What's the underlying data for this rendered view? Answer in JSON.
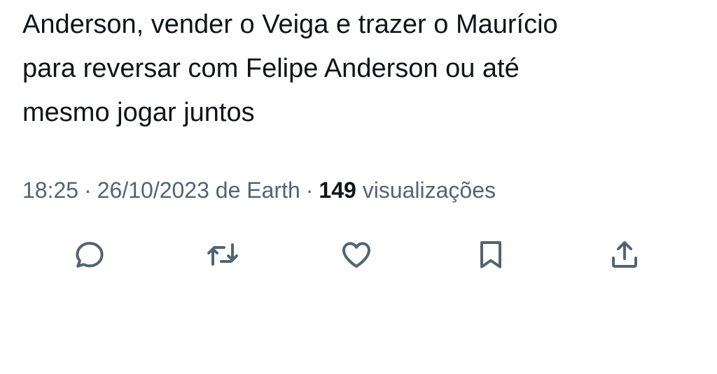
{
  "tweet": {
    "text_lines": [
      "Anderson, vender o Veiga e trazer o Maurício",
      "para reversar com Felipe Anderson ou até",
      "mesmo jogar juntos"
    ]
  },
  "meta": {
    "time": "18:25",
    "date": "26/10/2023",
    "source_prefix": "de",
    "source": "Earth",
    "separator": "·",
    "views_count": "149",
    "views_label": "visualizações"
  },
  "actions": {
    "reply_icon": "reply-icon",
    "retweet_icon": "retweet-icon",
    "like_icon": "heart-icon",
    "bookmark_icon": "bookmark-icon",
    "share_icon": "share-icon"
  },
  "colors": {
    "text": "#0f1419",
    "secondary": "#536471",
    "background": "#ffffff"
  }
}
